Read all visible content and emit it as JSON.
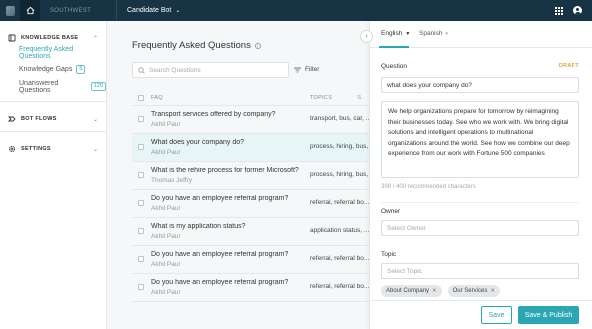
{
  "topbar": {
    "org_name": "SOUTHWEST",
    "bot_name": "Candidate Bot"
  },
  "sidebar": {
    "knowledge_base": {
      "title": "KNOWLEDGE BASE",
      "items": [
        {
          "label": "Frequently Asked Questions",
          "badge": ""
        },
        {
          "label": "Knowledge Gaps",
          "badge": "5"
        },
        {
          "label": "Unanswered Questions",
          "badge": "120"
        }
      ]
    },
    "bot_flows": {
      "title": "BOT FLOWS"
    },
    "settings": {
      "title": "SETTINGS"
    }
  },
  "main": {
    "title": "Frequently Asked Questions",
    "search_placeholder": "Search Questions",
    "filter_label": "Filter",
    "columns": {
      "faq": "FAQ",
      "topics": "TOPICS"
    },
    "rows": [
      {
        "question": "Transport services offered by company?",
        "author": "Akhil Paul",
        "topics": "transport, bus, car, ..."
      },
      {
        "question": "What does your company do?",
        "author": "Akhil Paul",
        "topics": "process, hiring, bus, ..."
      },
      {
        "question": "What is the rehire process for former Microsoft?",
        "author": "Thomas Jeffry",
        "topics": "process, hiring, bus, ..."
      },
      {
        "question": "Do you have an employee referral program?",
        "author": "Akhil Paul",
        "topics": "referral, referral bo..."
      },
      {
        "question": "What is my application status?",
        "author": "Akhil Paul",
        "topics": "application status, ..."
      },
      {
        "question": "Do you have an employee referral program?",
        "author": "Akhil Paul",
        "topics": "referral, referral bo..."
      },
      {
        "question": "Do you have an employee referral program?",
        "author": "Akhil Paul",
        "topics": "referral, referral bo..."
      }
    ]
  },
  "panel": {
    "tabs": {
      "english": "English",
      "spanish": "Spanish"
    },
    "question_label": "Question",
    "draft_label": "DRAFT",
    "question_value": "what does your company do?",
    "answer_value": "We help organizations prepare for tomorrow by reimagining their businesses today. See who we work with. We bring digital solutions and intelligent operations to multinational organizations around the world. See how we combine our deep experience from our work with Fortune 500 companies",
    "counter": "398 / 400 recommended characters",
    "owner_label": "Owner",
    "owner_placeholder": "Select Owner",
    "topic_label": "Topic",
    "topic_placeholder": "Select Topic",
    "chips": [
      "About Company",
      "Our Services"
    ],
    "save_label": "Save",
    "publish_label": "Save & Publish"
  },
  "colors": {
    "topbar": "#173344",
    "accent": "#2ba7b4",
    "draft": "#e8a33c",
    "selected_row": "#e8f5f6"
  }
}
